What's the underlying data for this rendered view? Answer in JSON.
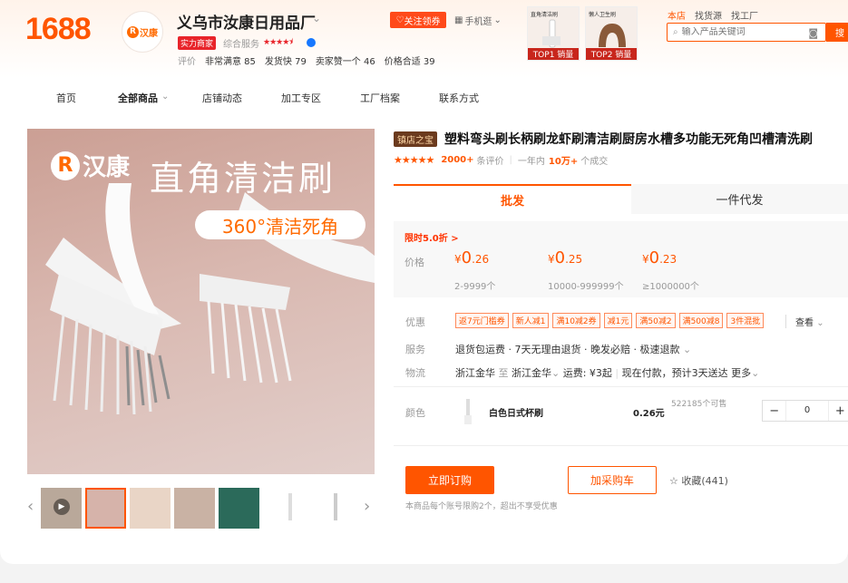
{
  "header": {
    "logo": "1688",
    "shop_avatar_text": "汉康",
    "shop_avatar_letter": "R",
    "shop_name": "义乌市汝康日用品厂",
    "strength_tag": "实力商家",
    "service_label": "综合服务",
    "service_stars": "★★★★⯨",
    "eval_label": "评价",
    "eval_items": [
      "非常满意 85",
      "发货快 79",
      "卖家赞一个 46",
      "价格合适 39"
    ],
    "follow_label": "关注领券",
    "phone_label": "手机逛",
    "top_thumbs": [
      {
        "badge": "TOP1 销量",
        "caption": "直角清洁刷"
      },
      {
        "badge": "TOP2 销量",
        "caption": "懒人卫生刷"
      }
    ],
    "search_tabs": [
      "本店",
      "找货源",
      "找工厂"
    ],
    "search_placeholder": "输入产品关键词",
    "search_button": "搜"
  },
  "nav": {
    "items": [
      "首页",
      "全部商品",
      "店铺动态",
      "加工专区",
      "工厂档案",
      "联系方式"
    ]
  },
  "gallery": {
    "brand_letter": "R",
    "brand_text": "汉康",
    "headline": "直角清洁刷",
    "pill": "360°清洁死角"
  },
  "product": {
    "hot_tag": "镇店之宝",
    "title": "塑料弯头刷长柄刷龙虾刷清洁刷厨房水槽多功能无死角凹槽清洗刷",
    "stars": "★★★★★",
    "reviews_count": "2000+",
    "reviews_label": "条评价",
    "sales_prefix": "一年内",
    "sales_count": "10万+",
    "sales_suffix": "个成交",
    "tabs": [
      "批发",
      "一件代发"
    ],
    "promo": "限时5.0折 >",
    "price_label": "价格",
    "currency": "¥",
    "prices": [
      {
        "int": "0",
        "dec": ".26",
        "qty": "2-9999个"
      },
      {
        "int": "0",
        "dec": ".25",
        "qty": "10000-999999个"
      },
      {
        "int": "0",
        "dec": ".23",
        "qty": "≥1000000个"
      }
    ],
    "coupon_label": "优惠",
    "coupons": [
      "返7元门槛券",
      "新人减1",
      "满10减2券",
      "减1元",
      "满50减2",
      "满500减8",
      "3件混批"
    ],
    "coupon_more": "查看",
    "service_label": "服务",
    "service_text": "退货包运费 · 7天无理由退货 · 晚发必赔 · 极速退款",
    "logistics_label": "物流",
    "logistics_from": "浙江金华",
    "logistics_to_word": "至",
    "logistics_to": "浙江金华",
    "logistics_fee": "运费: ¥3起",
    "logistics_note": "现在付款，预计3天送达",
    "logistics_more": "更多",
    "color_label": "颜色",
    "sku_name": "白色日式杯刷",
    "sku_price": "0.26元",
    "sku_stock": "522185个可售",
    "quantity": "0",
    "buy_label": "立即订购",
    "cart_label": "加采购车",
    "fav_label": "收藏(441)",
    "limit_note": "本商品每个账号限购2个，超出不享受优惠"
  },
  "colors": {
    "accent": "#ff5500",
    "strength_tag": "#e8242a",
    "hot_tag_bg": "#6b3a1e"
  }
}
